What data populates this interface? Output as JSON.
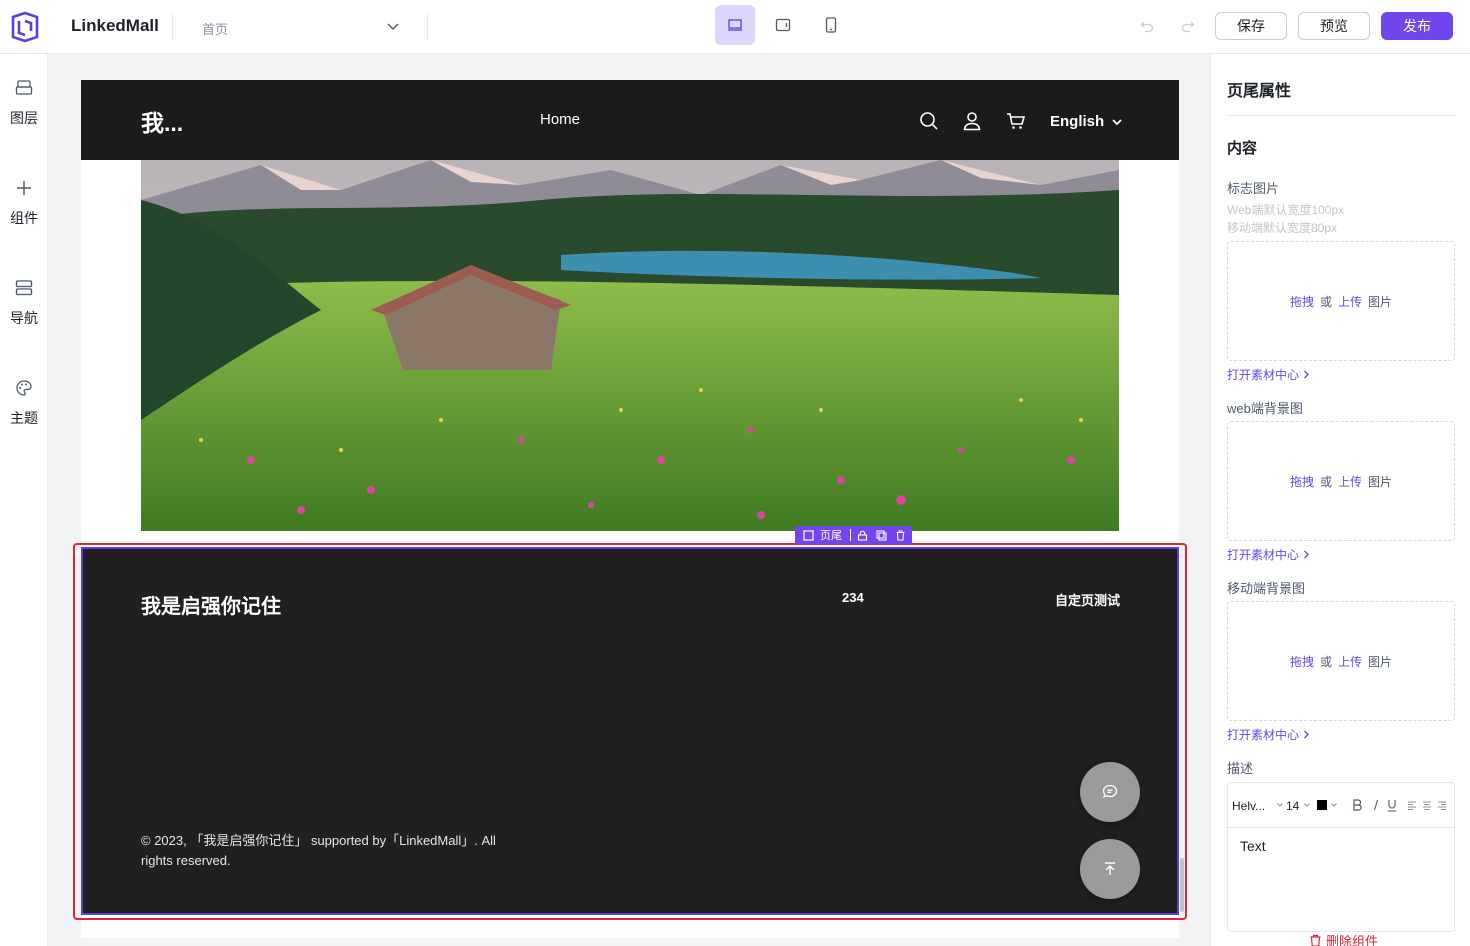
{
  "app": {
    "brand": "LinkedMall",
    "page_select": "首页",
    "actions": {
      "save": "保存",
      "preview": "预览",
      "publish": "发布"
    }
  },
  "colors": {
    "accent": "#7147ed",
    "selection": "#e0243a",
    "site_header_bg": "#1c1a1a",
    "footer_bg": "#211f22"
  },
  "left_rail": [
    {
      "label": "图层",
      "icon": "layers-icon"
    },
    {
      "label": "组件",
      "icon": "plus-icon"
    },
    {
      "label": "导航",
      "icon": "navigation-icon"
    },
    {
      "label": "主题",
      "icon": "palette-icon"
    }
  ],
  "site": {
    "logo": "我...",
    "nav": [
      "Home"
    ],
    "language": "English"
  },
  "footer": {
    "title": "我是启强你记住",
    "links": [
      "234",
      "自定页测试"
    ],
    "copyright": "© 2023, 「我是启强你记住」 supported by「LinkedMall」. All rights reserved.",
    "tag_label": "页尾"
  },
  "panel": {
    "title": "页尾属性",
    "section": "内容",
    "logo_label": "标志图片",
    "logo_hint_web": "Web端默认宽度100px",
    "logo_hint_mobile": "移动端默认宽度80px",
    "drop_drag": "拖拽",
    "drop_or": "或",
    "drop_upload": "上传",
    "drop_image": "图片",
    "open_library": "打开素材中心",
    "web_bg_label": "web端背景图",
    "mobile_bg_label": "移动端背景图",
    "desc_label": "描述",
    "editor": {
      "font": "Helv...",
      "size": "14",
      "text": "Text"
    },
    "delete": "删除组件"
  }
}
